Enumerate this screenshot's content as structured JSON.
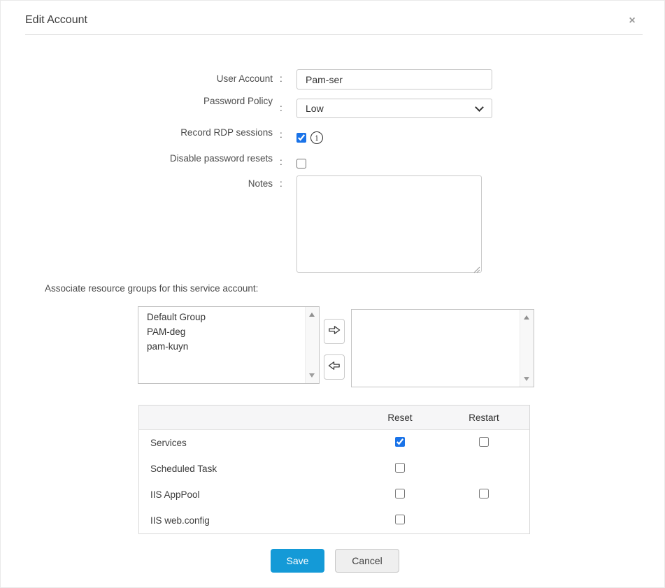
{
  "header": {
    "title": "Edit Account",
    "close_icon": "×"
  },
  "form": {
    "user_account": {
      "label": "User Account",
      "colon": ":",
      "value": "Pam-ser"
    },
    "password_policy": {
      "label": "Password Policy",
      "colon": ":",
      "value": "Low"
    },
    "record_rdp_sessions": {
      "label": "Record RDP sessions",
      "colon": ":",
      "checked": true,
      "info_icon": "i"
    },
    "disable_password_resets": {
      "label": "Disable password resets",
      "colon": ":",
      "checked": false
    },
    "notes": {
      "label": "Notes",
      "colon": ":",
      "value": ""
    }
  },
  "resource_groups": {
    "heading": "Associate resource groups for this service account:",
    "available": [
      "Default Group",
      "PAM-deg",
      "pam-kuyn"
    ],
    "assigned": []
  },
  "actions_table": {
    "columns": {
      "reset": "Reset",
      "restart": "Restart"
    },
    "rows": [
      {
        "label": "Services",
        "reset_checked": true,
        "restart_checked": false
      },
      {
        "label": "Scheduled Task",
        "reset_checked": false
      },
      {
        "label": "IIS AppPool",
        "reset_checked": false,
        "restart_checked": false
      },
      {
        "label": "IIS web.config",
        "reset_checked": false
      }
    ]
  },
  "footer": {
    "save": "Save",
    "cancel": "Cancel"
  },
  "colors": {
    "primary_button": "#149ad7",
    "checkbox_accent": "#1a73e8",
    "header_row_bg": "#f6f6f7",
    "title_text": "#3c3c3c"
  }
}
